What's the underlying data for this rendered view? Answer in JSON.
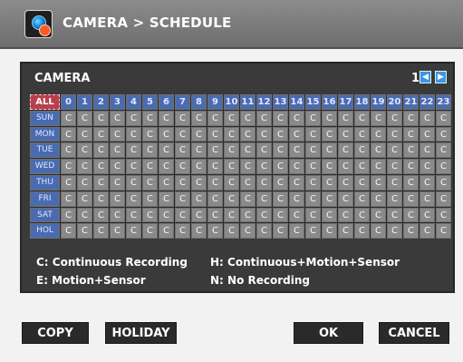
{
  "title": "CAMERA > SCHEDULE",
  "icon": "camera-record-icon",
  "camera": {
    "label": "CAMERA",
    "page": "1",
    "prev_icon": "chevron-left-icon",
    "next_icon": "chevron-right-icon"
  },
  "schedule": {
    "all_label": "ALL",
    "hours": [
      "0",
      "1",
      "2",
      "3",
      "4",
      "5",
      "6",
      "7",
      "8",
      "9",
      "10",
      "11",
      "12",
      "13",
      "14",
      "15",
      "16",
      "17",
      "18",
      "19",
      "20",
      "21",
      "22",
      "23"
    ],
    "rows": [
      {
        "day": "SUN",
        "values": [
          "C",
          "C",
          "C",
          "C",
          "C",
          "C",
          "C",
          "C",
          "C",
          "C",
          "C",
          "C",
          "C",
          "C",
          "C",
          "C",
          "C",
          "C",
          "C",
          "C",
          "C",
          "C",
          "C",
          "C"
        ]
      },
      {
        "day": "MON",
        "values": [
          "C",
          "C",
          "C",
          "C",
          "C",
          "C",
          "C",
          "C",
          "C",
          "C",
          "C",
          "C",
          "C",
          "C",
          "C",
          "C",
          "C",
          "C",
          "C",
          "C",
          "C",
          "C",
          "C",
          "C"
        ]
      },
      {
        "day": "TUE",
        "values": [
          "C",
          "C",
          "C",
          "C",
          "C",
          "C",
          "C",
          "C",
          "C",
          "C",
          "C",
          "C",
          "C",
          "C",
          "C",
          "C",
          "C",
          "C",
          "C",
          "C",
          "C",
          "C",
          "C",
          "C"
        ]
      },
      {
        "day": "WED",
        "values": [
          "C",
          "C",
          "C",
          "C",
          "C",
          "C",
          "C",
          "C",
          "C",
          "C",
          "C",
          "C",
          "C",
          "C",
          "C",
          "C",
          "C",
          "C",
          "C",
          "C",
          "C",
          "C",
          "C",
          "C"
        ]
      },
      {
        "day": "THU",
        "values": [
          "C",
          "C",
          "C",
          "C",
          "C",
          "C",
          "C",
          "C",
          "C",
          "C",
          "C",
          "C",
          "C",
          "C",
          "C",
          "C",
          "C",
          "C",
          "C",
          "C",
          "C",
          "C",
          "C",
          "C"
        ]
      },
      {
        "day": "FRI",
        "values": [
          "C",
          "C",
          "C",
          "C",
          "C",
          "C",
          "C",
          "C",
          "C",
          "C",
          "C",
          "C",
          "C",
          "C",
          "C",
          "C",
          "C",
          "C",
          "C",
          "C",
          "C",
          "C",
          "C",
          "C"
        ]
      },
      {
        "day": "SAT",
        "values": [
          "C",
          "C",
          "C",
          "C",
          "C",
          "C",
          "C",
          "C",
          "C",
          "C",
          "C",
          "C",
          "C",
          "C",
          "C",
          "C",
          "C",
          "C",
          "C",
          "C",
          "C",
          "C",
          "C",
          "C"
        ]
      },
      {
        "day": "HOL",
        "values": [
          "C",
          "C",
          "C",
          "C",
          "C",
          "C",
          "C",
          "C",
          "C",
          "C",
          "C",
          "C",
          "C",
          "C",
          "C",
          "C",
          "C",
          "C",
          "C",
          "C",
          "C",
          "C",
          "C",
          "C"
        ]
      }
    ]
  },
  "legend": {
    "c": "C: Continuous Recording",
    "h": "H: Continuous+Motion+Sensor",
    "e": "E: Motion+Sensor",
    "n": "N: No Recording"
  },
  "buttons": {
    "copy": "COPY",
    "holiday": "HOLIDAY",
    "ok": "OK",
    "cancel": "CANCEL"
  },
  "colors": {
    "header_cell": "#4b6bb0",
    "selected_cell": "#b8404b",
    "schedule_cell": "#8a8a8a"
  }
}
